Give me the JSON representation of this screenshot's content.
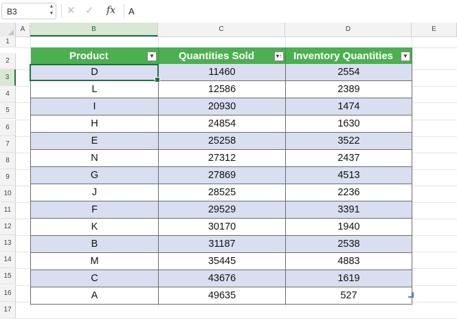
{
  "formula_bar": {
    "cell_ref": "B3",
    "fx_label": "fx",
    "cancel_glyph": "✕",
    "confirm_glyph": "✓",
    "content": "A"
  },
  "columns": [
    "A",
    "B",
    "C",
    "D",
    "E"
  ],
  "rows": [
    "1",
    "2",
    "3",
    "4",
    "5",
    "6",
    "7",
    "8",
    "9",
    "10",
    "11",
    "12",
    "13",
    "14",
    "15",
    "16",
    "17"
  ],
  "table": {
    "headers": [
      "Product",
      "Quantities Sold",
      "Inventory Quantities"
    ],
    "filter_icons": [
      "▼",
      "▾↑",
      "▼"
    ],
    "header_color": "#4caf50",
    "band_color": "#d9def0",
    "rows": [
      [
        "D",
        "11460",
        "2554"
      ],
      [
        "L",
        "12586",
        "2389"
      ],
      [
        "I",
        "20930",
        "1474"
      ],
      [
        "H",
        "24854",
        "1630"
      ],
      [
        "E",
        "25258",
        "3522"
      ],
      [
        "N",
        "27312",
        "2437"
      ],
      [
        "G",
        "27869",
        "4513"
      ],
      [
        "J",
        "28525",
        "2236"
      ],
      [
        "F",
        "29529",
        "3391"
      ],
      [
        "K",
        "30170",
        "1940"
      ],
      [
        "B",
        "31187",
        "2538"
      ],
      [
        "M",
        "35445",
        "4883"
      ],
      [
        "C",
        "43676",
        "1619"
      ],
      [
        "A",
        "49635",
        "527"
      ]
    ]
  },
  "selection": {
    "active_cell": "B3",
    "accent": "#1e7145"
  }
}
